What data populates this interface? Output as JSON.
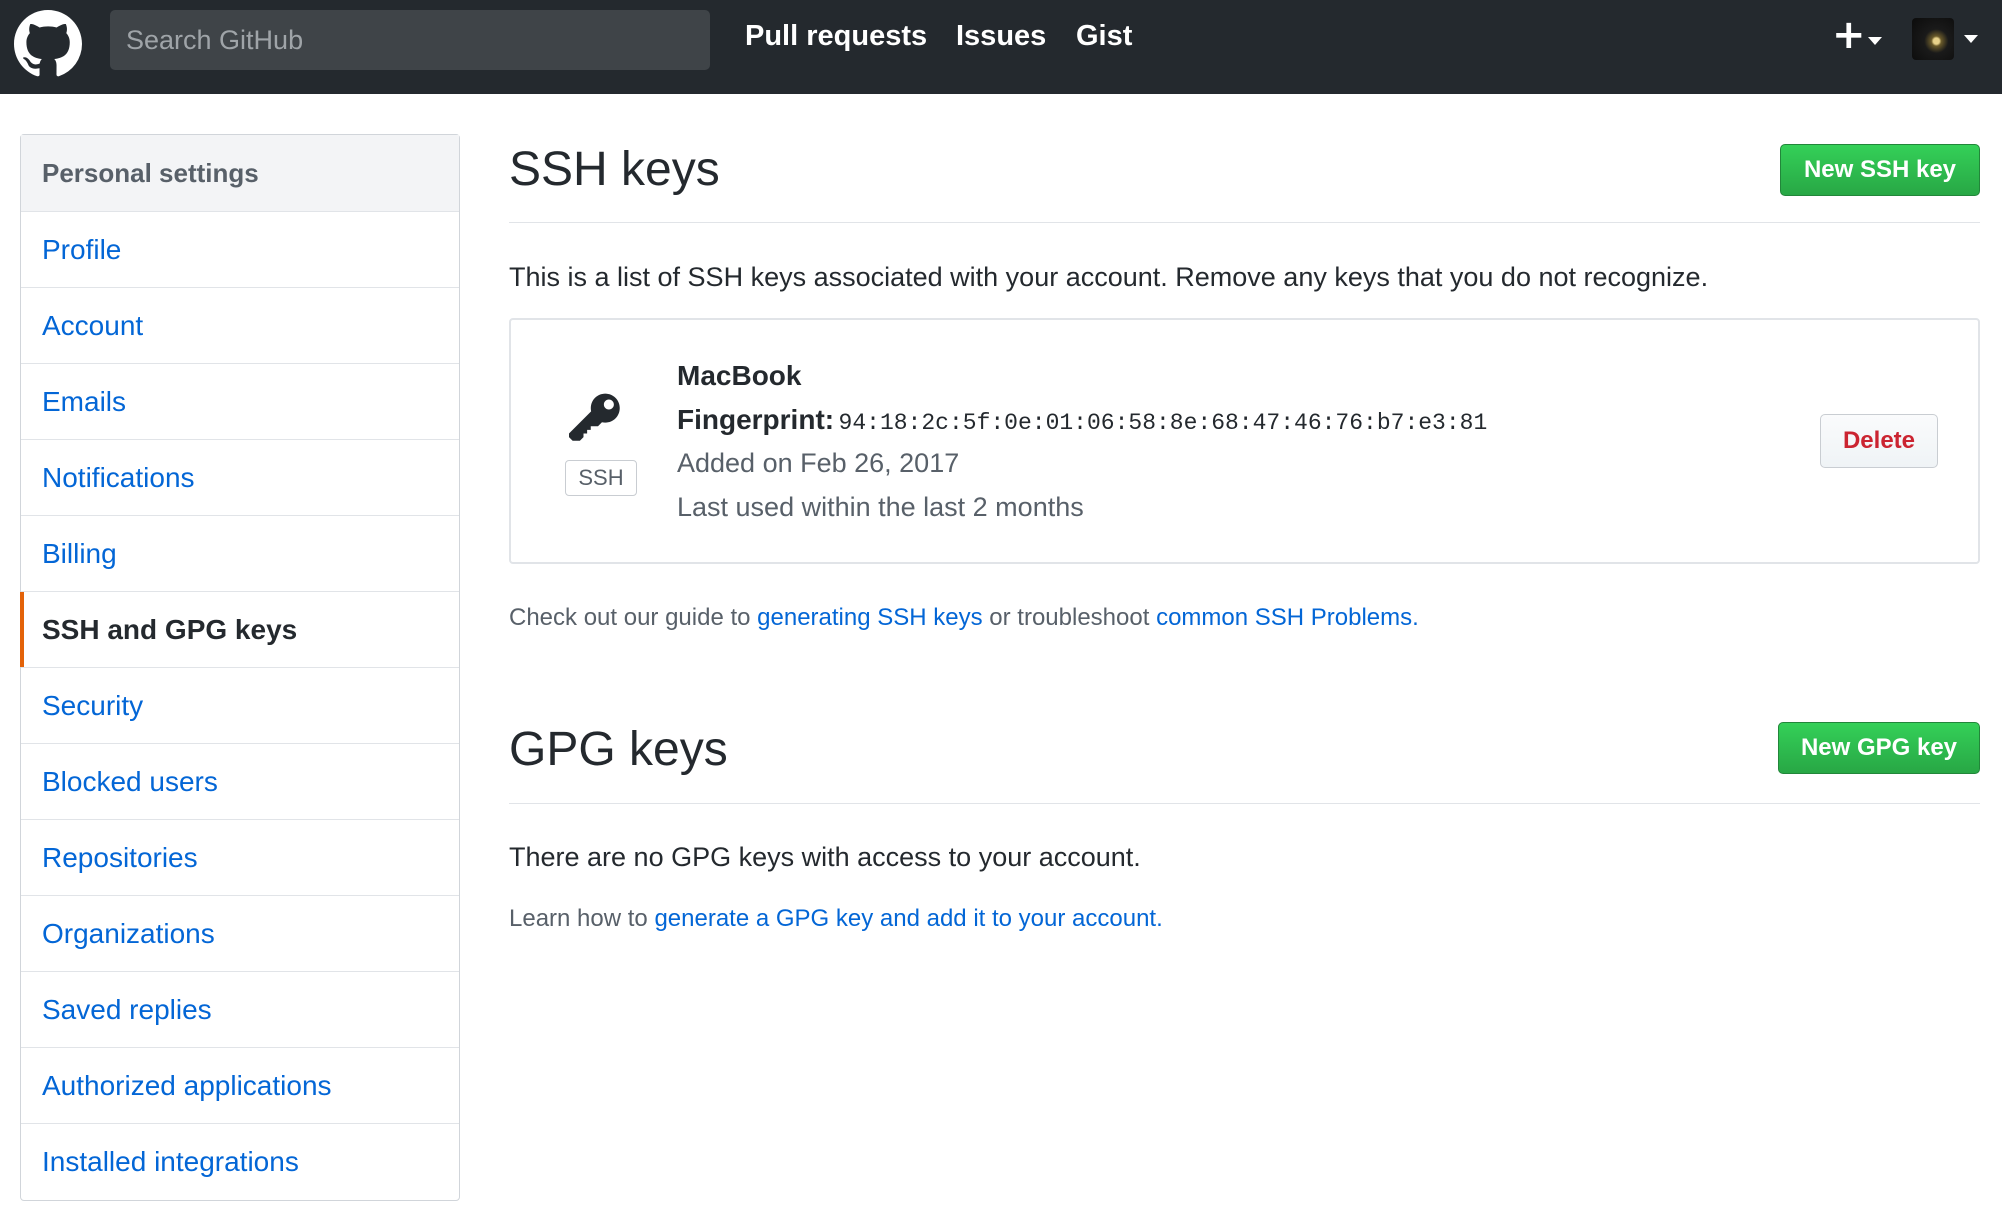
{
  "header": {
    "search_placeholder": "Search GitHub",
    "nav": [
      "Pull requests",
      "Issues",
      "Gist"
    ],
    "plus_symbol": "+"
  },
  "sidebar": {
    "title": "Personal settings",
    "items": [
      {
        "label": "Profile",
        "selected": false
      },
      {
        "label": "Account",
        "selected": false
      },
      {
        "label": "Emails",
        "selected": false
      },
      {
        "label": "Notifications",
        "selected": false
      },
      {
        "label": "Billing",
        "selected": false
      },
      {
        "label": "SSH and GPG keys",
        "selected": true
      },
      {
        "label": "Security",
        "selected": false
      },
      {
        "label": "Blocked users",
        "selected": false
      },
      {
        "label": "Repositories",
        "selected": false
      },
      {
        "label": "Organizations",
        "selected": false
      },
      {
        "label": "Saved replies",
        "selected": false
      },
      {
        "label": "Authorized applications",
        "selected": false
      },
      {
        "label": "Installed integrations",
        "selected": false
      }
    ]
  },
  "ssh": {
    "title": "SSH keys",
    "new_button": "New SSH key",
    "description": "This is a list of SSH keys associated with your account. Remove any keys that you do not recognize.",
    "key": {
      "badge": "SSH",
      "name": "MacBook",
      "fingerprint_label": "Fingerprint:",
      "fingerprint": "94:18:2c:5f:0e:01:06:58:8e:68:47:46:76:b7:e3:81",
      "added": "Added on Feb 26, 2017",
      "last_used": "Last used within the last 2 months",
      "delete_button": "Delete"
    },
    "guide": {
      "prefix": "Check out our guide to ",
      "link1": "generating SSH keys",
      "middle": " or troubleshoot ",
      "link2": "common SSH Problems",
      "suffix": "."
    }
  },
  "gpg": {
    "title": "GPG keys",
    "new_button": "New GPG key",
    "empty": "There are no GPG keys with access to your account.",
    "learn": {
      "prefix": "Learn how to ",
      "link": "generate a GPG key and add it to your account",
      "suffix": "."
    }
  },
  "colors": {
    "header_bg": "#24292e",
    "link": "#0366d6",
    "green": "#28a745",
    "selected_marker": "#e36209",
    "danger": "#cb2431"
  }
}
